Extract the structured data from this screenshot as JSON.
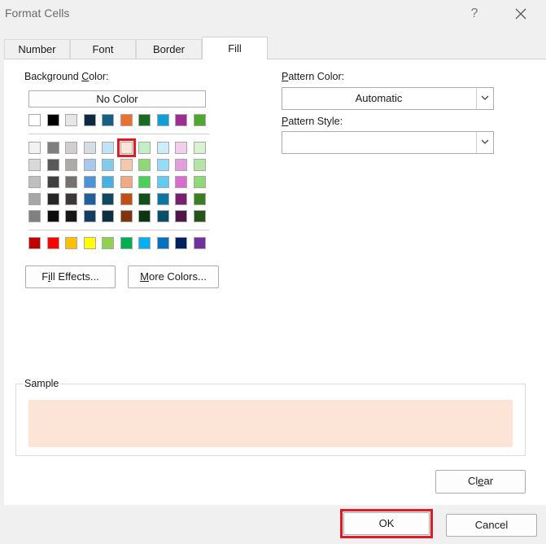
{
  "window": {
    "title": "Format Cells",
    "help_glyph": "?"
  },
  "tabs": [
    {
      "label": "Number"
    },
    {
      "label": "Font"
    },
    {
      "label": "Border"
    },
    {
      "label": "Fill"
    }
  ],
  "fill": {
    "background_color_label_pre": "Background ",
    "background_color_label_key": "C",
    "background_color_label_post": "olor:",
    "no_color_label": "No Color",
    "fill_effects_label_pre": "F",
    "fill_effects_label_key": "i",
    "fill_effects_label_post": "ll Effects...",
    "more_colors_label_key": "M",
    "more_colors_label_post": "ore Colors...",
    "pattern_color_label_key": "P",
    "pattern_color_label_post": "attern Color:",
    "pattern_color_value": "Automatic",
    "pattern_style_label_key": "P",
    "pattern_style_label_post": "attern Style:",
    "pattern_style_value": "",
    "sample_label": "Sample",
    "sample_color": "#fce4d6",
    "clear_label_pre": "Cl",
    "clear_label_key": "e",
    "clear_label_post": "ar",
    "theme_colors": [
      [
        "#ffffff",
        "#000000",
        "#e7e6e6",
        "#0e2841",
        "#156082",
        "#e97132",
        "#196b24",
        "#0f9ed5",
        "#a02b93",
        "#4ea72e"
      ]
    ],
    "tint_colors": [
      [
        "#f2f2f2",
        "#7f7f7f",
        "#d0cece",
        "#d6dce4",
        "#c0e4f5",
        "#fce4d6",
        "#c1f0c8",
        "#cbecf9",
        "#f2ceed",
        "#d9f2d0"
      ],
      [
        "#d9d9d9",
        "#595959",
        "#aeaaaa",
        "#a6c9ec",
        "#83cbeb",
        "#f7c7ac",
        "#8ed973",
        "#94dcf8",
        "#e59edd",
        "#b4e5a2"
      ],
      [
        "#bfbfbf",
        "#404040",
        "#767171",
        "#4d93d9",
        "#45b0e1",
        "#f1a983",
        "#47d359",
        "#61cbf3",
        "#d86dcd",
        "#8ed973"
      ],
      [
        "#a6a6a6",
        "#262626",
        "#3a3838",
        "#215f9a",
        "#104862",
        "#c04f15",
        "#124f1a",
        "#0b76a0",
        "#78206e",
        "#3a7d22"
      ],
      [
        "#808080",
        "#0d0d0d",
        "#161616",
        "#153d64",
        "#0c2f3f",
        "#80340e",
        "#0d3512",
        "#074f6a",
        "#501549",
        "#275317"
      ]
    ],
    "standard_colors": [
      [
        "#c00000",
        "#ff0000",
        "#ffc000",
        "#ffff00",
        "#92d050",
        "#00b050",
        "#00b0f0",
        "#0070c0",
        "#002060",
        "#7030a0"
      ]
    ],
    "selected_swatch": {
      "group": "tint",
      "row": 0,
      "col": 5
    }
  },
  "footer": {
    "ok_label": "OK",
    "cancel_label": "Cancel"
  },
  "accent_highlight": "#e01b24"
}
